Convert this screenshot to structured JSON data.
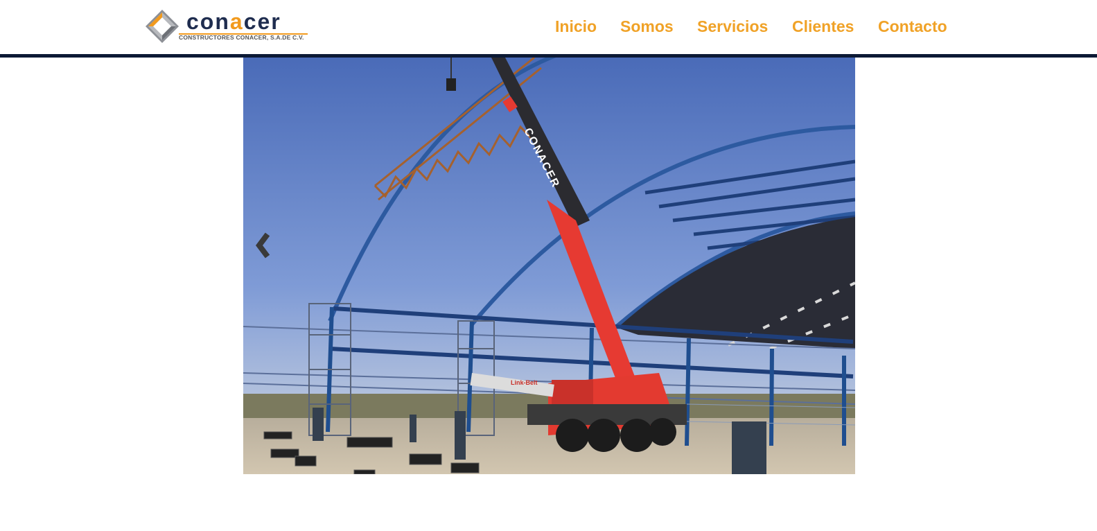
{
  "brand": {
    "wordmark_pre": "con",
    "wordmark_accent": "a",
    "wordmark_post": "cer",
    "tagline": "CONSTRUCTORES CONACER, S.A.DE C.V.",
    "colors": {
      "navy": "#1f2d4f",
      "orange": "#f29a1d"
    }
  },
  "nav": {
    "items": [
      {
        "label": "Inicio"
      },
      {
        "label": "Somos"
      },
      {
        "label": "Servicios"
      },
      {
        "label": "Clientes"
      },
      {
        "label": "Contacto"
      }
    ],
    "color": "#f0a227"
  },
  "slider": {
    "crane_boom_text": "CONACER",
    "crane_brand_text": "Link-Belt",
    "prev_icon": "chevron-left-icon"
  }
}
